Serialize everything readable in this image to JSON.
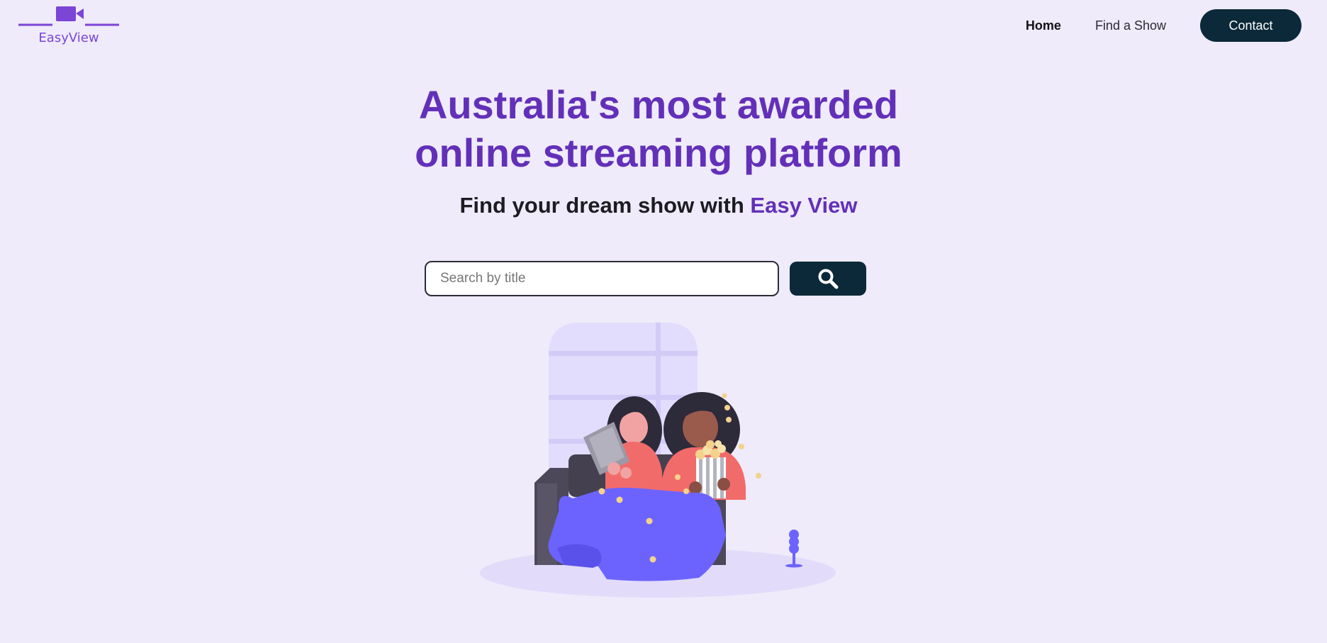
{
  "header": {
    "logo_text": "EasyView",
    "logo_icon": "video-camera-icon",
    "nav": [
      {
        "label": "Home",
        "active": true
      },
      {
        "label": "Find a Show",
        "active": false
      }
    ],
    "contact_label": "Contact"
  },
  "hero": {
    "title_line1": "Australia's most awarded",
    "title_line2": "online streaming platform",
    "subtitle_prefix": "Find your dream show with ",
    "subtitle_brand": "Easy View"
  },
  "search": {
    "placeholder": "Search by title",
    "value": "",
    "button_icon": "search-icon"
  },
  "colors": {
    "background": "#efebfa",
    "brand_purple": "#6230b8",
    "dark_button": "#0b2938",
    "blanket": "#6c63ff"
  }
}
